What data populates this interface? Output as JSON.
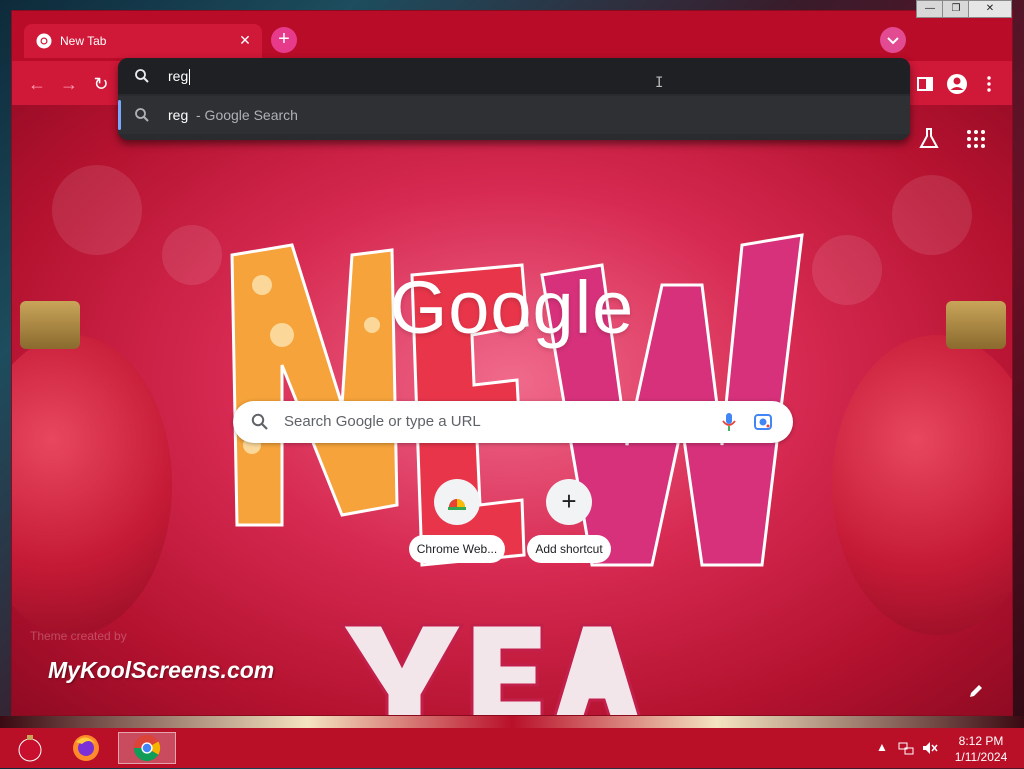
{
  "window": {
    "tab": {
      "title": "New Tab",
      "close": "✕"
    },
    "newtab_symbol": "+",
    "window_controls": {
      "minimize": "—",
      "maximize": "❐",
      "close": "✕"
    }
  },
  "omnibox": {
    "input_value": "reg",
    "suggestion": {
      "term": "reg",
      "description": "- Google Search"
    }
  },
  "ntp": {
    "logo_text": "Google",
    "search_placeholder": "Search Google or type a URL",
    "shortcuts": [
      {
        "label": "Chrome Web..."
      },
      {
        "label": "Add shortcut",
        "symbol": "+"
      }
    ],
    "watermark": "MyKoolScreens.com",
    "theme_credit": "Theme created by"
  },
  "taskbar": {
    "time": "8:12 PM",
    "date": "1/11/2024"
  },
  "colors": {
    "chrome_red": "#c8102e",
    "omnibox_bg": "#2a2b2e",
    "accent_blue": "#7aa7ff"
  }
}
